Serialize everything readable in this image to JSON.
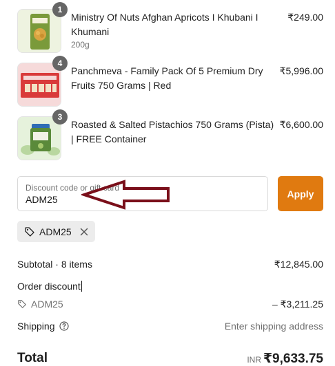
{
  "items": [
    {
      "badge": "1",
      "name": "Ministry Of Nuts Afghan Apricots I Khubani I Khumani",
      "variant": "200g",
      "price": "₹249.00"
    },
    {
      "badge": "4",
      "name": "Panchmeva - Family Pack Of 5 Premium Dry Fruits 750 Grams | Red",
      "variant": "",
      "price": "₹5,996.00"
    },
    {
      "badge": "3",
      "name": "Roasted & Salted Pistachios 750 Grams (Pista) | FREE Container",
      "variant": "",
      "price": "₹6,600.00"
    }
  ],
  "discount": {
    "label": "Discount code or gift card",
    "value": "ADM25",
    "apply_label": "Apply",
    "applied_code": "ADM25"
  },
  "summary": {
    "subtotal_label": "Subtotal · 8 items",
    "subtotal_value": "₹12,845.00",
    "order_discount_label": "Order discount",
    "discount_code": "ADM25",
    "discount_value": "– ₹3,211.25",
    "shipping_label": "Shipping",
    "shipping_value": "Enter shipping address",
    "total_label": "Total",
    "total_currency": "INR",
    "total_value": "₹9,633.75"
  },
  "colors": {
    "apply_button": "#e07a10",
    "annotation_arrow": "#7a0f1a"
  }
}
